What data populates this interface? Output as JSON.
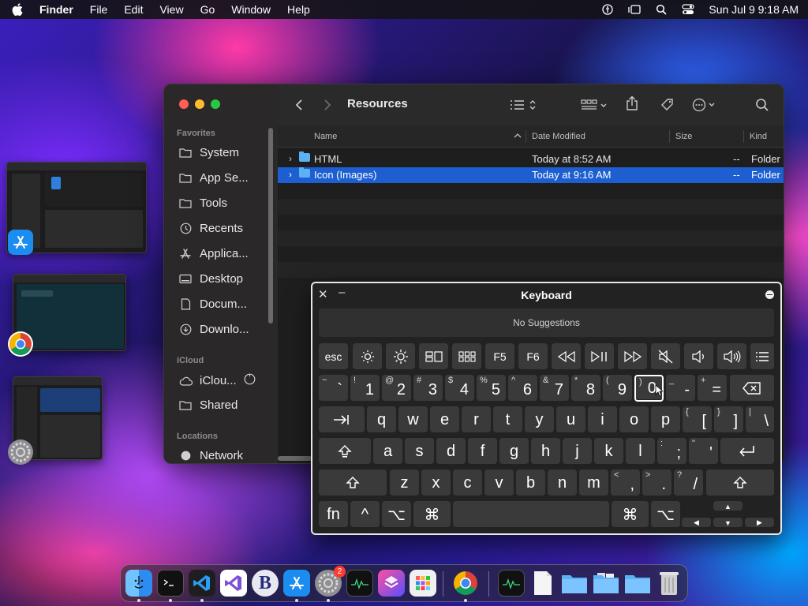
{
  "menubar": {
    "app_name": "Finder",
    "items": [
      "File",
      "Edit",
      "View",
      "Go",
      "Window",
      "Help"
    ],
    "clock": "Sun Jul 9  9:18 AM"
  },
  "finder": {
    "title": "Resources",
    "sidebar": {
      "favorites_label": "Favorites",
      "favorites": [
        "System",
        "App Se...",
        "Tools",
        "Recents",
        "Applica...",
        "Desktop",
        "Docum...",
        "Downlo..."
      ],
      "icloud_label": "iCloud",
      "icloud": [
        "iClou...",
        "Shared"
      ],
      "locations_label": "Locations",
      "locations": [
        "Network"
      ]
    },
    "columns": {
      "name": "Name",
      "date": "Date Modified",
      "size": "Size",
      "kind": "Kind"
    },
    "rows": [
      {
        "name": "HTML",
        "date": "Today at 8:52 AM",
        "size": "--",
        "kind": "Folder",
        "selected": false
      },
      {
        "name": "Icon (Images)",
        "date": "Today at 9:16 AM",
        "size": "--",
        "kind": "Folder",
        "selected": true
      }
    ]
  },
  "keyboard": {
    "title": "Keyboard",
    "suggestions": "No Suggestions",
    "fn_row": [
      "esc",
      "☼",
      "☀",
      "▭▭",
      "▦",
      "F5",
      "F6",
      "◁◁",
      "▷||",
      "▷▷",
      "🔇",
      "🔈",
      "🔊",
      "☰"
    ],
    "num_row": [
      {
        "top": "~",
        "main": "`"
      },
      {
        "top": "!",
        "main": "1"
      },
      {
        "top": "@",
        "main": "2"
      },
      {
        "top": "#",
        "main": "3"
      },
      {
        "top": "$",
        "main": "4"
      },
      {
        "top": "%",
        "main": "5"
      },
      {
        "top": "^",
        "main": "6"
      },
      {
        "top": "&",
        "main": "7"
      },
      {
        "top": "*",
        "main": "8"
      },
      {
        "top": "(",
        "main": "9"
      },
      {
        "top": ")",
        "main": "0"
      },
      {
        "top": "_",
        "main": "-"
      },
      {
        "top": "+",
        "main": "="
      }
    ],
    "row_q": [
      "q",
      "w",
      "e",
      "r",
      "t",
      "y",
      "u",
      "i",
      "o",
      "p"
    ],
    "row_q_extra": [
      {
        "top": "{",
        "main": "["
      },
      {
        "top": "}",
        "main": "]"
      },
      {
        "top": "|",
        "main": "\\"
      }
    ],
    "row_a": [
      "a",
      "s",
      "d",
      "f",
      "g",
      "h",
      "j",
      "k",
      "l"
    ],
    "row_a_extra": [
      {
        "top": ":",
        "main": ";"
      },
      {
        "top": "\"",
        "main": "'"
      }
    ],
    "row_z": [
      "z",
      "x",
      "c",
      "v",
      "b",
      "n",
      "m"
    ],
    "row_z_extra": [
      {
        "top": "<",
        "main": ","
      },
      {
        "top": ">",
        "main": "."
      },
      {
        "top": "?",
        "main": "/"
      }
    ],
    "bottom": {
      "fn": "fn",
      "ctrl": "^",
      "opt": "⌥",
      "cmd": "⌘"
    }
  },
  "dock": {
    "apps": [
      "Finder",
      "Terminal",
      "VS Code",
      "Visual Studio",
      "BBEdit",
      "App Store",
      "System Settings",
      "Activity Monitor",
      "Shortcuts",
      "Launchpad",
      "Chrome",
      "Activity Monitor",
      "TextEdit",
      "Folder",
      "Folder",
      "Folder",
      "Trash"
    ],
    "settings_badge": "2"
  },
  "colors": {
    "selection": "#1d5fd1",
    "folder": "#5ab2f5",
    "close": "#ff5f57",
    "minimize": "#febc2e",
    "zoom": "#28c840"
  }
}
